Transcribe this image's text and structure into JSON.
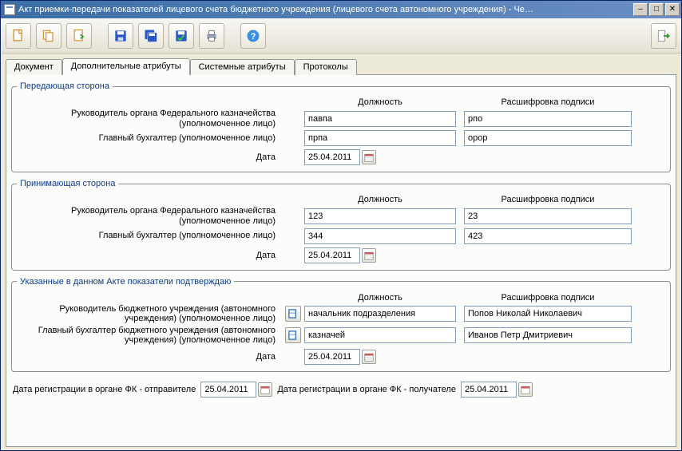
{
  "window": {
    "title": "Акт приемки-передачи показателей лицевого счета бюджетного учреждения (лицевого счета автономного учреждения) - Че…"
  },
  "tabs": {
    "document": "Документ",
    "extra": "Дополнительные атрибуты",
    "system": "Системные атрибуты",
    "protocols": "Протоколы"
  },
  "headers": {
    "position": "Должность",
    "signature": "Расшифровка подписи"
  },
  "groups": {
    "sender": {
      "legend": "Передающая сторона",
      "head_label": "Руководитель органа Федерального казначейства (уполномоченное лицо)",
      "accountant_label": "Главный бухгалтер (уполномоченное лицо)",
      "head_position": "павпа",
      "head_signature": "рпо",
      "acc_position": "прпа",
      "acc_signature": "орор",
      "date_label": "Дата",
      "date": "25.04.2011"
    },
    "receiver": {
      "legend": "Принимающая сторона",
      "head_label": "Руководитель органа Федерального казначейства (уполномоченное лицо)",
      "accountant_label": "Главный бухгалтер (уполномоченное лицо)",
      "head_position": "123",
      "head_signature": "23",
      "acc_position": "344",
      "acc_signature": "423",
      "date_label": "Дата",
      "date": "25.04.2011"
    },
    "confirm": {
      "legend": "Указанные в данном Акте показатели подтверждаю",
      "head_label": "Руководитель бюджетного учреждения (автономного учреждения) (уполномоченное лицо)",
      "accountant_label": "Главный бухгалтер бюджетного учреждения (автономного учреждения) (уполномоченное лицо)",
      "head_position": "начальник подразделения",
      "head_signature": "Попов Николай Николаевич",
      "acc_position": "казначей",
      "acc_signature": "Иванов Петр Дмитриевич",
      "date_label": "Дата",
      "date": "25.04.2011"
    }
  },
  "footer": {
    "sender_label": "Дата регистрации в органе ФК - отправителе",
    "sender_date": "25.04.2011",
    "receiver_label": "Дата регистрации в органе ФК - получателе",
    "receiver_date": "25.04.2011"
  }
}
